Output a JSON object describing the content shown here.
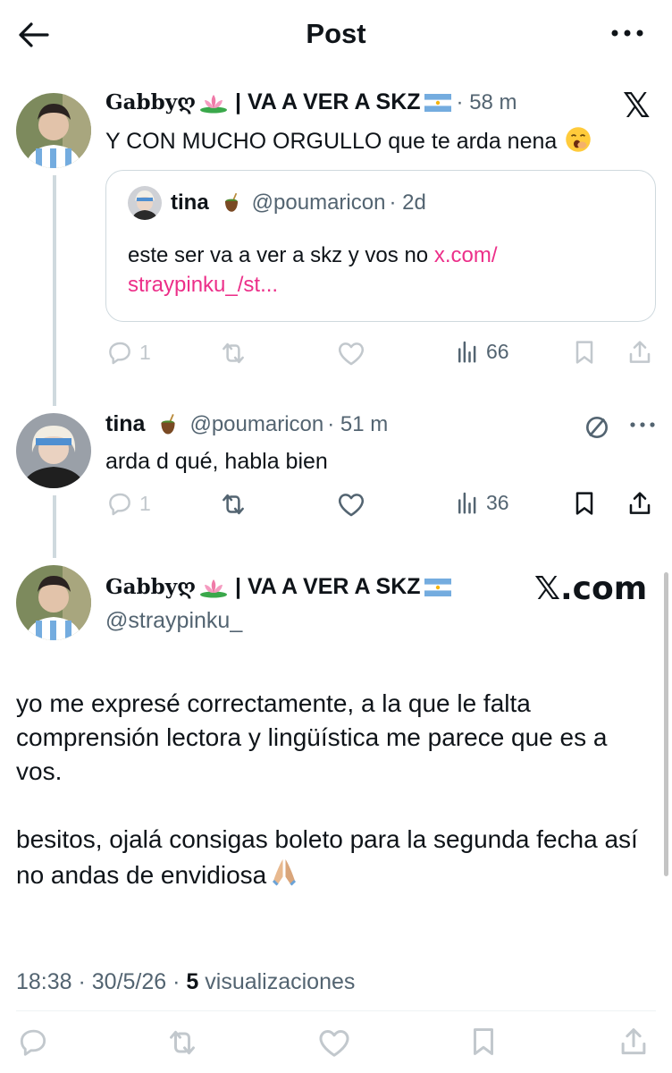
{
  "header": {
    "title": "Post"
  },
  "post1": {
    "display_name": "Gabbyღ",
    "name_suffix": "| VA A VER A SKZ",
    "time": "· 58 m",
    "text": "Y CON MUCHO ORGULLO que te arda nena",
    "logo": "𝕏",
    "quote": {
      "name": "tina",
      "handle": "@poumaricon",
      "time": "· 2d",
      "text": "este ser va a ver a skz y vos no",
      "link": "x.com/ straypinku_/st..."
    },
    "actions": {
      "replies": "1",
      "views": "66"
    }
  },
  "reply": {
    "name": "tina",
    "handle": "@poumaricon",
    "time": "· 51 m",
    "text": "arda d qué, habla bien",
    "actions": {
      "replies": "1",
      "views": "36"
    }
  },
  "main": {
    "display_name": "Gabbyღ",
    "name_suffix": "| VA A VER A SKZ",
    "handle": "@straypinku_",
    "logo_text": "𝕏.com",
    "paragraph1": "yo me expresé correctamente, a la que le falta comprensión lectora y lingüística me parece que es a vos.",
    "paragraph2": "besitos, ojalá consigas boleto para la segunda fecha así no andas de envidiosa",
    "timestamp": "18:38 · 30/5/26 · ",
    "views_count": "5",
    "views_label": " visualizaciones"
  },
  "icons": {
    "back": "arrow-left-icon",
    "more": "more-icon",
    "reply": "reply-icon",
    "repost": "repost-icon",
    "like": "heart-icon",
    "views": "views-icon",
    "bookmark": "bookmark-icon",
    "share": "share-icon"
  },
  "colors": {
    "link": "#ec2f89",
    "muted": "#536471",
    "text": "#0f1419",
    "border": "#cfd9de"
  }
}
